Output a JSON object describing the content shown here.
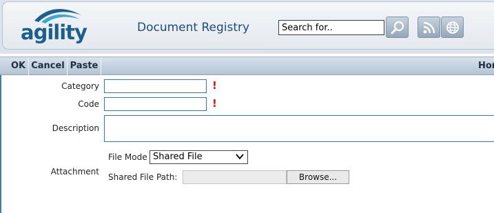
{
  "header": {
    "logo_text": "agility",
    "title": "Document Registry",
    "search": {
      "value": "Search for..",
      "placeholder": "Search for.."
    }
  },
  "toolbar": {
    "ok_label": "OK",
    "cancel_label": "Cancel",
    "paste_label": "Paste",
    "home_label": "Hor"
  },
  "form": {
    "category_label": "Category",
    "code_label": "Code",
    "description_label": "Description",
    "attachment_label": "Attachment",
    "required_mark": "!",
    "file_mode_label": "File Mode",
    "file_mode_value": "Shared File",
    "shared_path_label": "Shared File Path:",
    "browse_label": "Browse..."
  },
  "colors": {
    "brand": "#1a5f8e",
    "title": "#1c4d7a",
    "field_border": "#2d7fa0",
    "required": "#e01010"
  },
  "icons": [
    "search-icon",
    "rss-icon",
    "globe-icon",
    "chevron-down-icon"
  ]
}
